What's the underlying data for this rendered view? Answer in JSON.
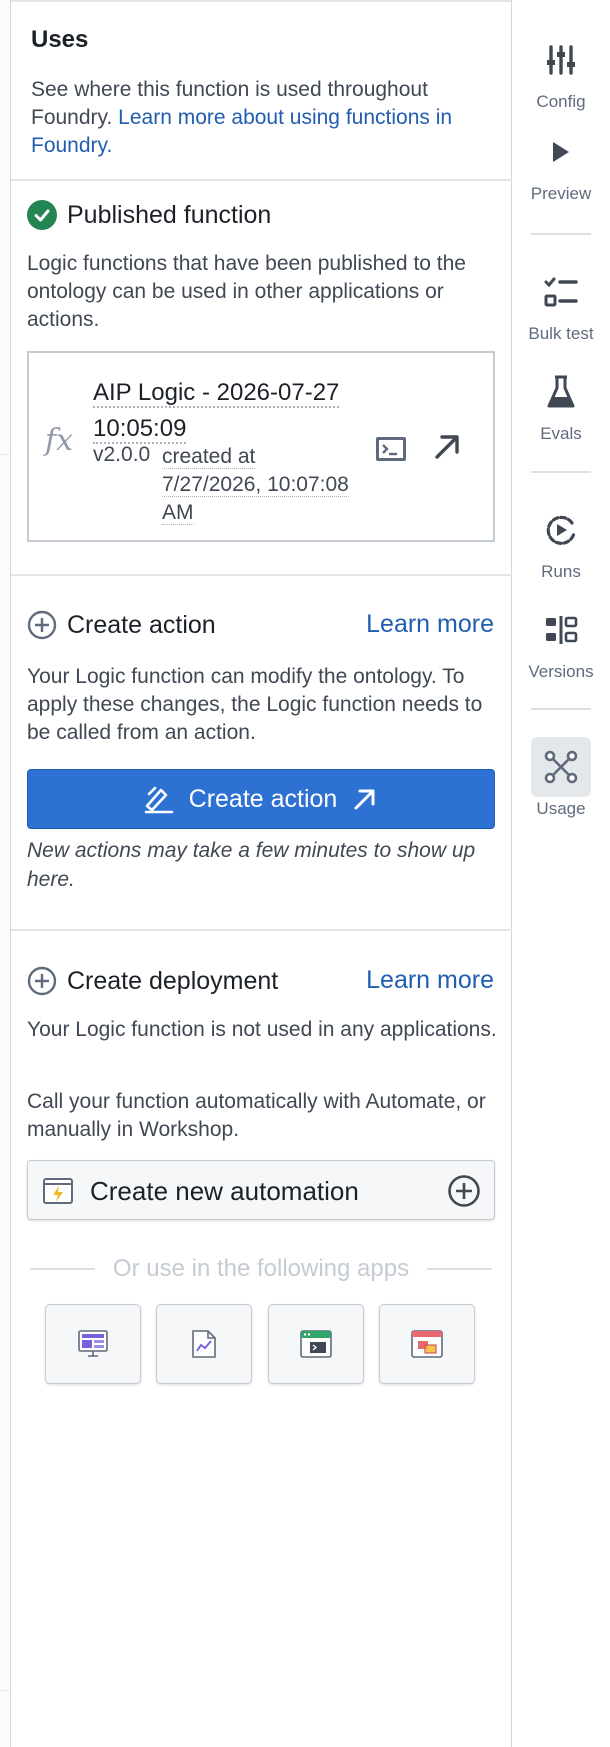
{
  "uses": {
    "title": "Uses",
    "description": "See where this function is used throughout Foundry.",
    "learn_link": "Learn more about using functions in Foundry."
  },
  "published": {
    "title": "Published function",
    "description": "Logic functions that have been published to the ontology can be used in other applications or actions.",
    "function_name": "AIP Logic - 2026-07-27 10:05:09",
    "version": "v2.0.0",
    "created_prefix": "created at",
    "created_at": "7/27/2026, 10:07:08 AM",
    "fx_glyph": "fx"
  },
  "create_action": {
    "title": "Create action",
    "learn_more": "Learn more",
    "description": "Your Logic function can modify the ontology. To apply these changes, the Logic function needs to be called from an action.",
    "button_label": "Create action",
    "hint": "New actions may take a few minutes to show up here."
  },
  "create_deployment": {
    "title": "Create deployment",
    "learn_more": "Learn more",
    "description_1": "Your Logic function is not used in any applications.",
    "description_2": "Call your function automatically with Automate, or manually in Workshop.",
    "automation_label": "Create new automation",
    "or_text": "Or use in the following apps"
  },
  "rail": {
    "config": "Config",
    "preview": "Preview",
    "bulk_test": "Bulk test",
    "evals": "Evals",
    "runs": "Runs",
    "versions": "Versions",
    "usage": "Usage",
    "active": "Usage"
  },
  "icons": {
    "rail": [
      "sliders-icon",
      "play-icon",
      "checklist-icon",
      "flask-icon",
      "runs-icon",
      "versions-icon",
      "graph-icon"
    ],
    "apps": [
      "workshop-app-icon",
      "report-app-icon",
      "console-app-icon",
      "slate-app-icon"
    ]
  },
  "colors": {
    "primary": "#2d72d2",
    "link": "#215db0",
    "success": "#238551",
    "text": "#1c2127",
    "muted": "#404854"
  }
}
